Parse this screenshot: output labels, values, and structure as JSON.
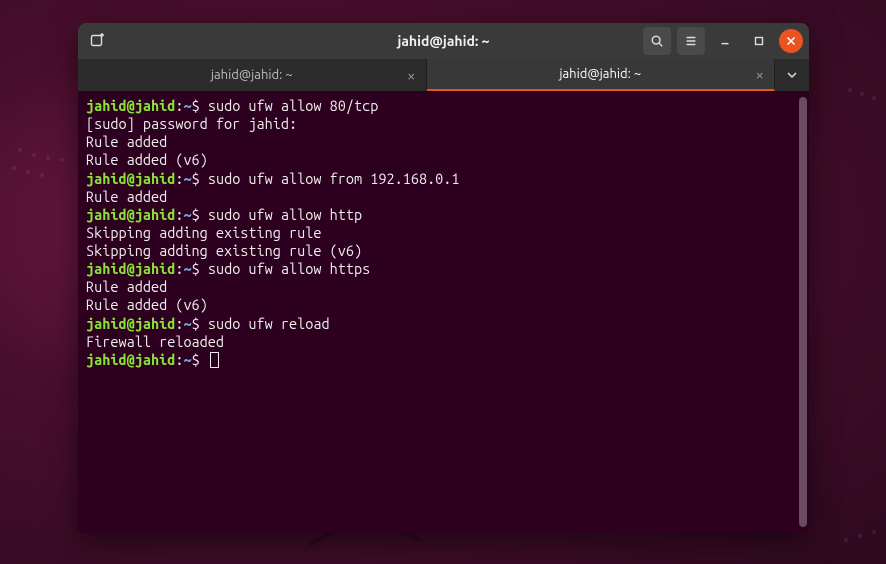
{
  "titlebar": {
    "title": "jahid@jahid: ~"
  },
  "tabs": [
    {
      "label": "jahid@jahid: ~",
      "active": false
    },
    {
      "label": "jahid@jahid: ~",
      "active": true
    }
  ],
  "prompt": {
    "userhost": "jahid@jahid",
    "sep": ":",
    "path": "~",
    "dollar": "$"
  },
  "lines": [
    {
      "t": "prompt",
      "cmd": "sudo ufw allow 80/tcp"
    },
    {
      "t": "out",
      "text": "[sudo] password for jahid: "
    },
    {
      "t": "out",
      "text": "Rule added"
    },
    {
      "t": "out",
      "text": "Rule added (v6)"
    },
    {
      "t": "prompt",
      "cmd": "sudo ufw allow from 192.168.0.1"
    },
    {
      "t": "out",
      "text": "Rule added"
    },
    {
      "t": "prompt",
      "cmd": "sudo ufw allow http"
    },
    {
      "t": "out",
      "text": "Skipping adding existing rule"
    },
    {
      "t": "out",
      "text": "Skipping adding existing rule (v6)"
    },
    {
      "t": "prompt",
      "cmd": "sudo ufw allow https"
    },
    {
      "t": "out",
      "text": "Rule added"
    },
    {
      "t": "out",
      "text": "Rule added (v6)"
    },
    {
      "t": "prompt",
      "cmd": "sudo ufw reload"
    },
    {
      "t": "out",
      "text": "Firewall reloaded"
    },
    {
      "t": "prompt",
      "cmd": "",
      "cursor": true
    }
  ],
  "colors": {
    "accent": "#e95420",
    "prompt_user": "#8ae234",
    "prompt_path": "#729fcf",
    "bg": "#2c001e"
  }
}
